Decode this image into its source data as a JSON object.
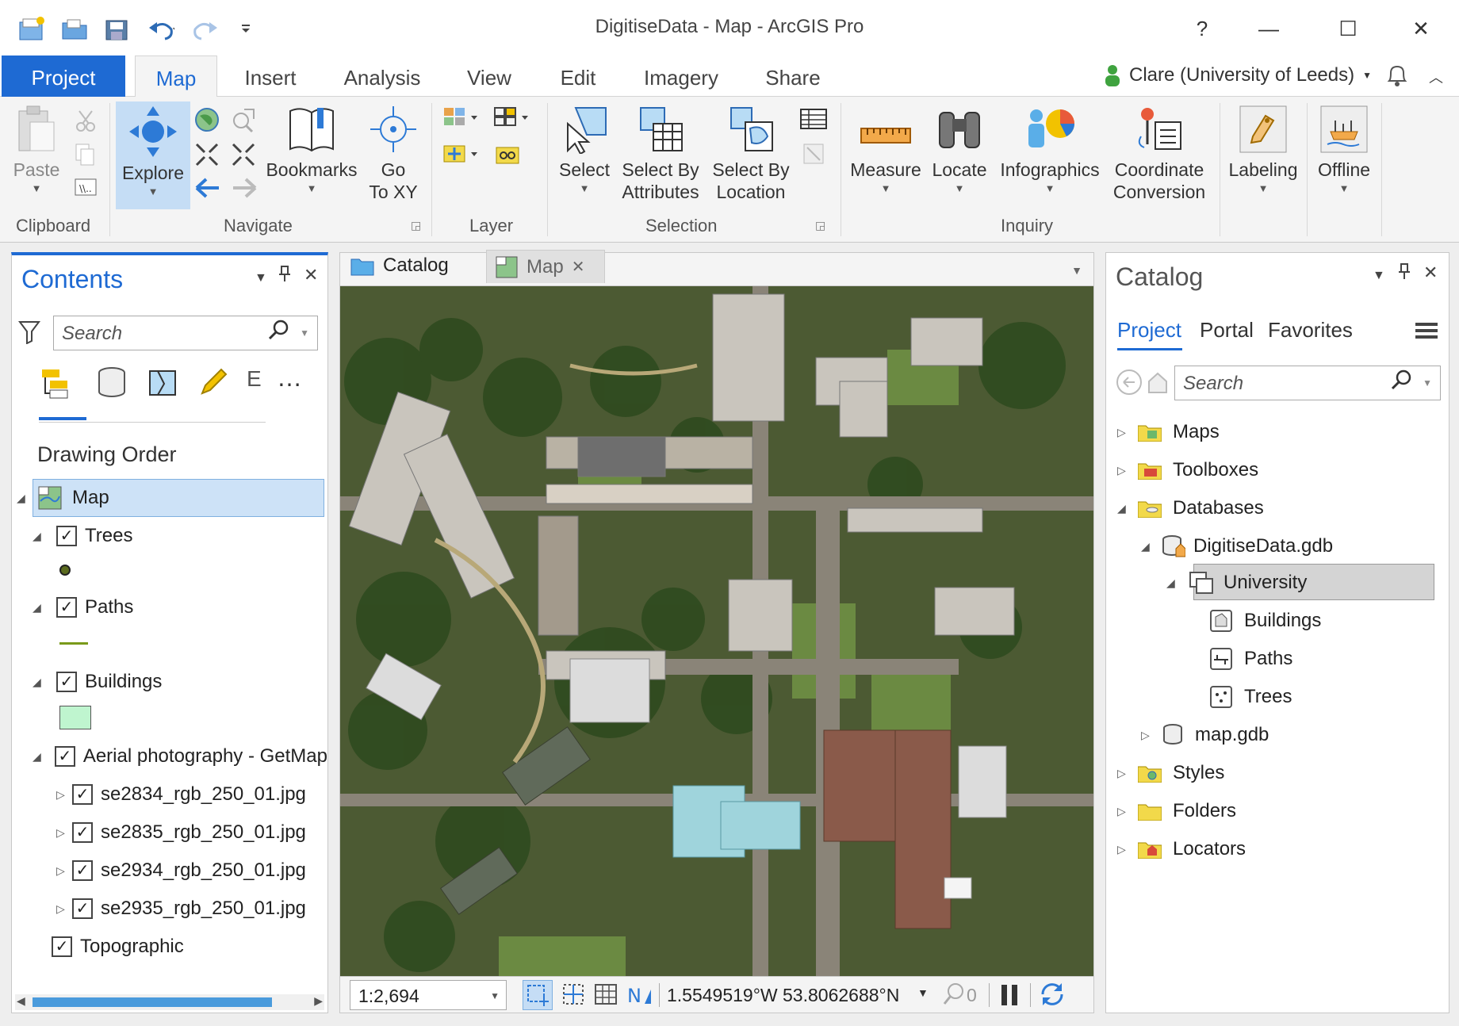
{
  "window": {
    "title": "DigitiseData - Map - ArcGIS Pro",
    "help": "?",
    "minimize": "—",
    "maximize": "☐",
    "close": "✕"
  },
  "tabs": [
    "Project",
    "Map",
    "Insert",
    "Analysis",
    "View",
    "Edit",
    "Imagery",
    "Share"
  ],
  "user": "Clare (University of Leeds)",
  "ribbon": {
    "clipboard": {
      "paste": "Paste",
      "group": "Clipboard"
    },
    "navigate": {
      "explore": "Explore",
      "bookmarks": "Bookmarks",
      "goto_1": "Go",
      "goto_2": "To XY",
      "group": "Navigate"
    },
    "layer": {
      "group": "Layer"
    },
    "selection": {
      "select": "Select",
      "by_attr_1": "Select By",
      "by_attr_2": "Attributes",
      "by_loc_1": "Select By",
      "by_loc_2": "Location",
      "group": "Selection"
    },
    "inquiry": {
      "measure": "Measure",
      "locate": "Locate",
      "infographics": "Infographics",
      "coord_1": "Coordinate",
      "coord_2": "Conversion",
      "group": "Inquiry"
    },
    "labeling": "Labeling",
    "offline": "Offline"
  },
  "contents": {
    "title": "Contents",
    "search_placeholder": "Search",
    "section": "Drawing Order",
    "map": "Map",
    "layers": {
      "trees": "Trees",
      "paths": "Paths",
      "buildings": "Buildings",
      "aerial": "Aerial photography - GetMap",
      "img1": "se2834_rgb_250_01.jpg",
      "img2": "se2835_rgb_250_01.jpg",
      "img3": "se2934_rgb_250_01.jpg",
      "img4": "se2935_rgb_250_01.jpg",
      "topo": "Topographic"
    }
  },
  "mapview": {
    "tab_catalog": "Catalog",
    "tab_map": "Map",
    "scale": "1:2,694",
    "coords": "1.5549519°W 53.8062688°N",
    "selected_count": "0"
  },
  "catalog": {
    "title": "Catalog",
    "tabs": [
      "Project",
      "Portal",
      "Favorites"
    ],
    "search_placeholder": "Search",
    "items": {
      "maps": "Maps",
      "toolboxes": "Toolboxes",
      "databases": "Databases",
      "gdb": "DigitiseData.gdb",
      "university": "University",
      "buildings": "Buildings",
      "paths": "Paths",
      "trees": "Trees",
      "mapgdb": "map.gdb",
      "styles": "Styles",
      "folders": "Folders",
      "locators": "Locators"
    }
  },
  "colors": {
    "accent": "#1e6ad3",
    "buildings_fill": "#bff5cf",
    "paths_line": "#7a9a1a",
    "trees_point": "#5b6b1e"
  }
}
